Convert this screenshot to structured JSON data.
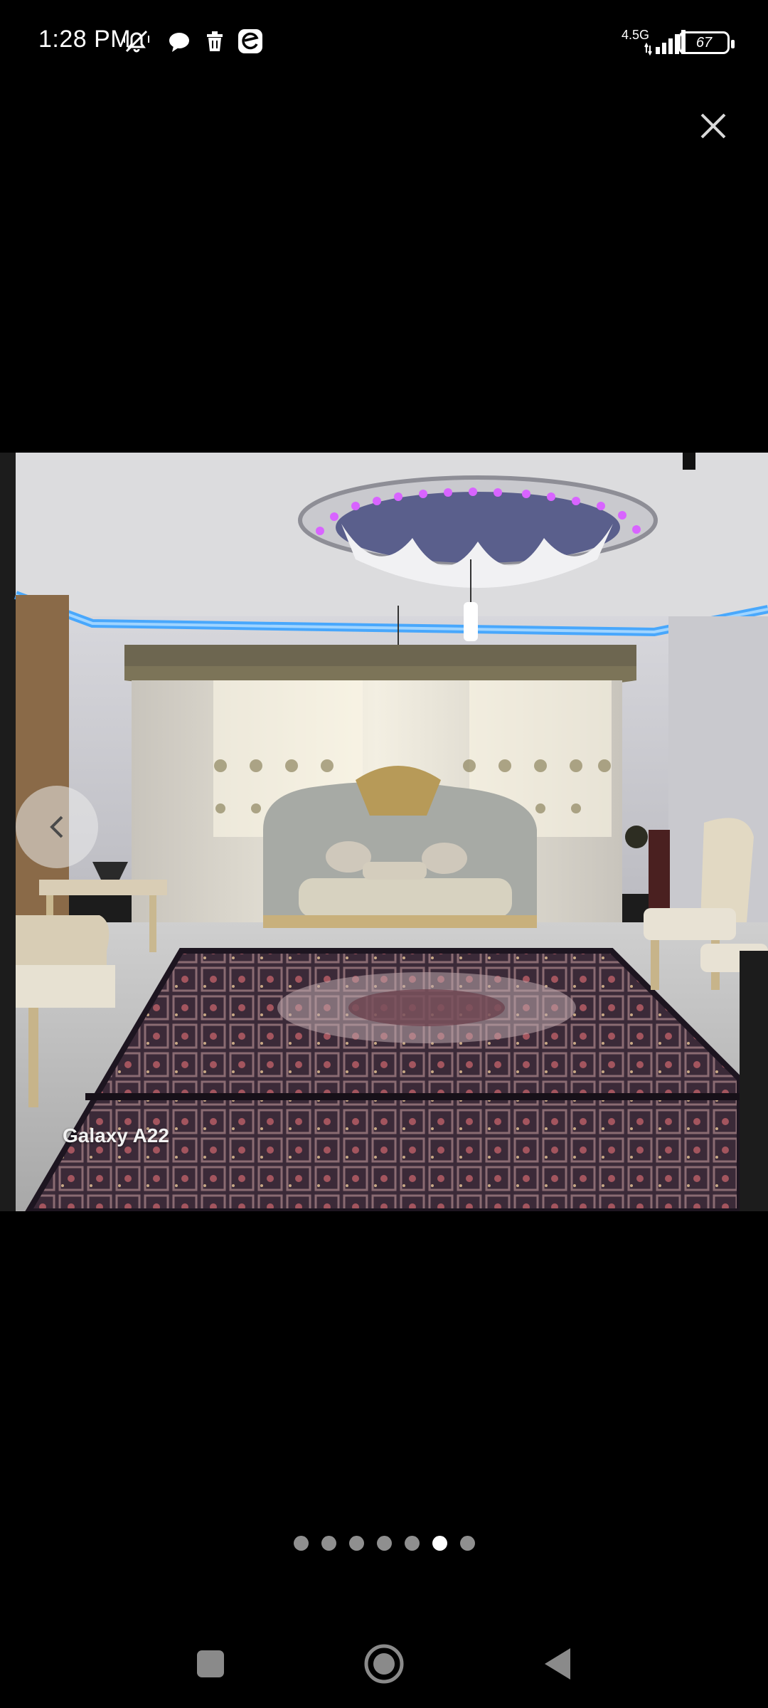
{
  "status_bar": {
    "time": "1:28 PM",
    "icons": [
      "mute-icon",
      "message-icon",
      "trash-icon",
      "edge-browser-icon"
    ],
    "network_label": "4.5G",
    "battery_level": "67"
  },
  "viewer": {
    "close_label": "×",
    "photo_watermark": "Galaxy A22",
    "prev_icon": "chevron-left-icon",
    "page_count": 7,
    "current_page": 6
  },
  "nav_bar": {
    "buttons": [
      "recent-apps",
      "home",
      "back"
    ]
  }
}
